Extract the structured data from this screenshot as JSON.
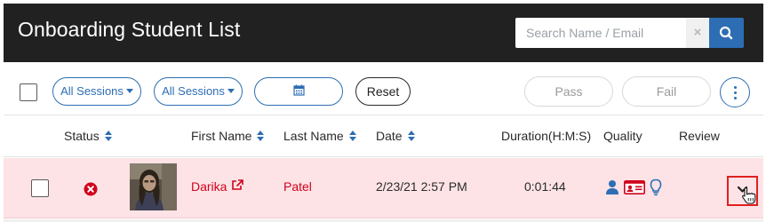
{
  "header": {
    "title": "Onboarding Student List",
    "search": {
      "placeholder": "Search Name / Email",
      "value": ""
    },
    "clear_label": "×",
    "search_icon": "search-icon"
  },
  "toolbar": {
    "session_filter_1": "All Sessions",
    "session_filter_2": "All Sessions",
    "date_picker_icon": "calendar-icon",
    "reset_label": "Reset",
    "pass_label": "Pass",
    "fail_label": "Fail",
    "more_icon": "vertical-ellipsis-icon"
  },
  "table": {
    "columns": {
      "status": "Status",
      "first_name": "First Name",
      "last_name": "Last Name",
      "date": "Date",
      "duration": "Duration(H:M:S)",
      "quality": "Quality",
      "review": "Review"
    },
    "rows": [
      {
        "status_icon": "error-circle-icon",
        "first_name": "Darika",
        "last_name": "Patel",
        "date": "2/23/21 2:57 PM",
        "duration": "0:01:44",
        "quality_icons": [
          "person-icon",
          "id-card-icon",
          "lightbulb-icon"
        ],
        "review_icon": "chevron-down-icon"
      }
    ]
  },
  "colors": {
    "header_bg": "#212121",
    "accent": "#2d6db3",
    "row_highlight": "#fde3e6",
    "error_red": "#d0021b"
  }
}
